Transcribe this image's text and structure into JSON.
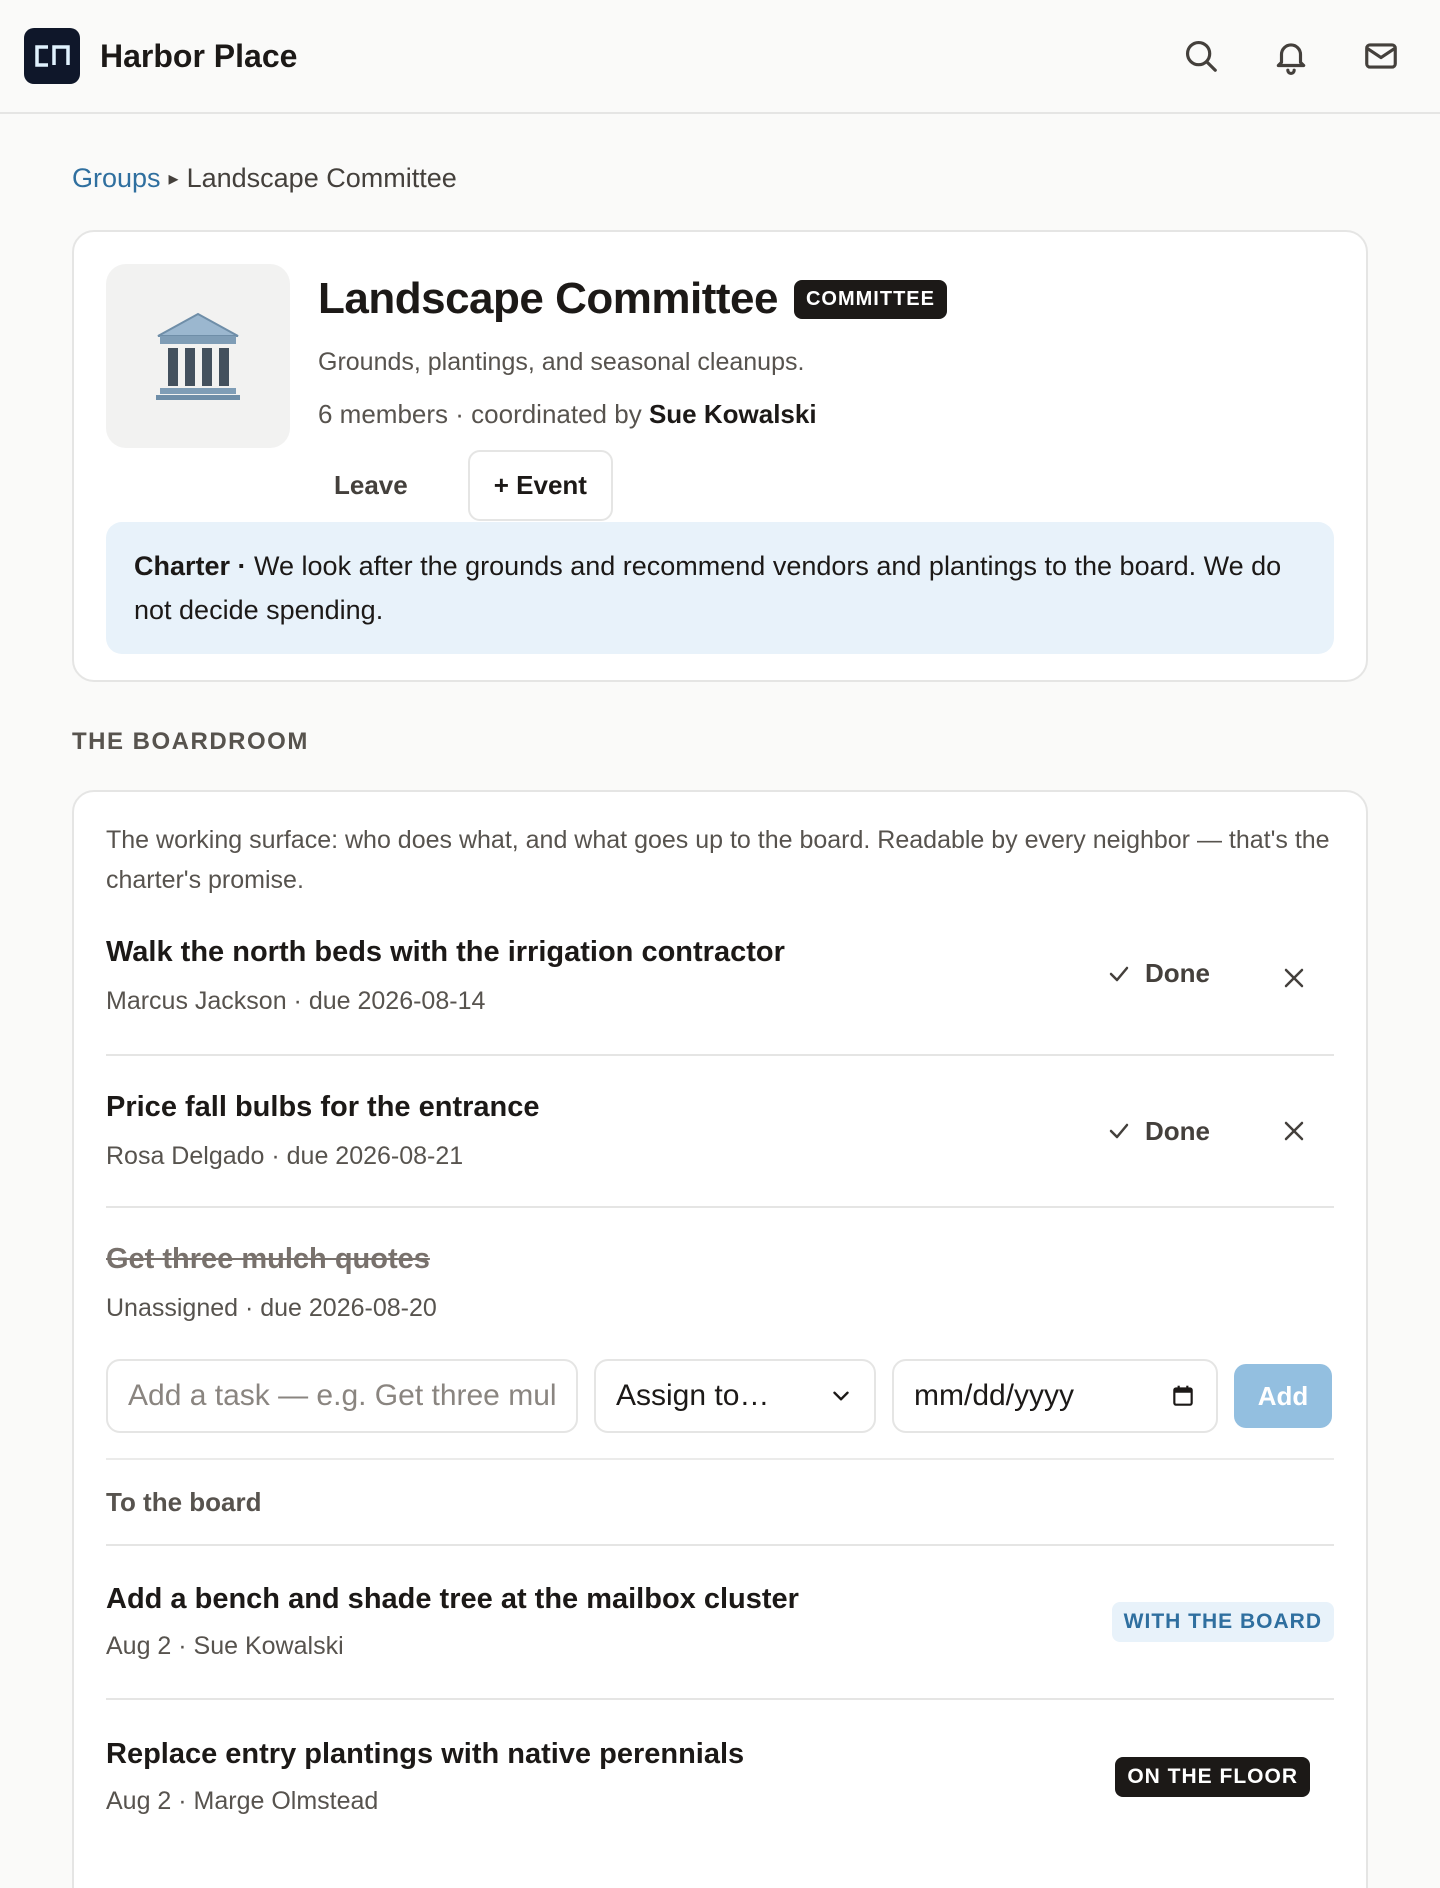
{
  "header": {
    "logo_text": "cn",
    "app_title": "Harbor Place",
    "icons": [
      "search-icon",
      "bell-icon",
      "mail-icon"
    ]
  },
  "breadcrumb": {
    "parent": "Groups",
    "separator": "▸",
    "current": "Landscape Committee"
  },
  "group": {
    "icon": "classical-building-icon",
    "title": "Landscape Committee",
    "badge": "COMMITTEE",
    "description": "Grounds, plantings, and seasonal cleanups.",
    "meta_prefix": "6 members · coordinated by",
    "coordinator": "Sue Kowalski",
    "leave_label": "Leave",
    "event_label": "+ Event",
    "charter_label": "Charter ·",
    "charter_text": " We look after the grounds and recommend vendors and plantings to the board. We do not decide spending."
  },
  "boardroom": {
    "section_label": "THE BOARDROOM",
    "intro": "The working surface: who does what, and what goes up to the board. Readable by every neighbor — that's the charter's promise.",
    "done_label": "Done",
    "tasks": [
      {
        "title": "Walk the north beds with the irrigation contractor",
        "meta": "Marcus Jackson · due 2026-08-14",
        "completed": false
      },
      {
        "title": "Price fall bulbs for the entrance",
        "meta": "Rosa Delgado · due 2026-08-21",
        "completed": false
      },
      {
        "title": "Get three mulch quotes",
        "meta": "Unassigned · due 2026-08-20",
        "completed": true
      }
    ],
    "add_form": {
      "task_placeholder": "Add a task — e.g. Get three mul",
      "assign_value": "Assign to…",
      "date_value": "mm/dd/yyyy",
      "add_label": "Add"
    },
    "to_board_label": "To the board",
    "proposals": [
      {
        "title": "Add a bench and shade tree at the mailbox cluster",
        "meta": "Aug 2 · Sue Kowalski",
        "status": "WITH THE BOARD"
      },
      {
        "title": "Replace entry plantings with native perennials",
        "meta": "Aug 2 · Marge Olmstead",
        "status": "ON THE FLOOR"
      }
    ]
  }
}
